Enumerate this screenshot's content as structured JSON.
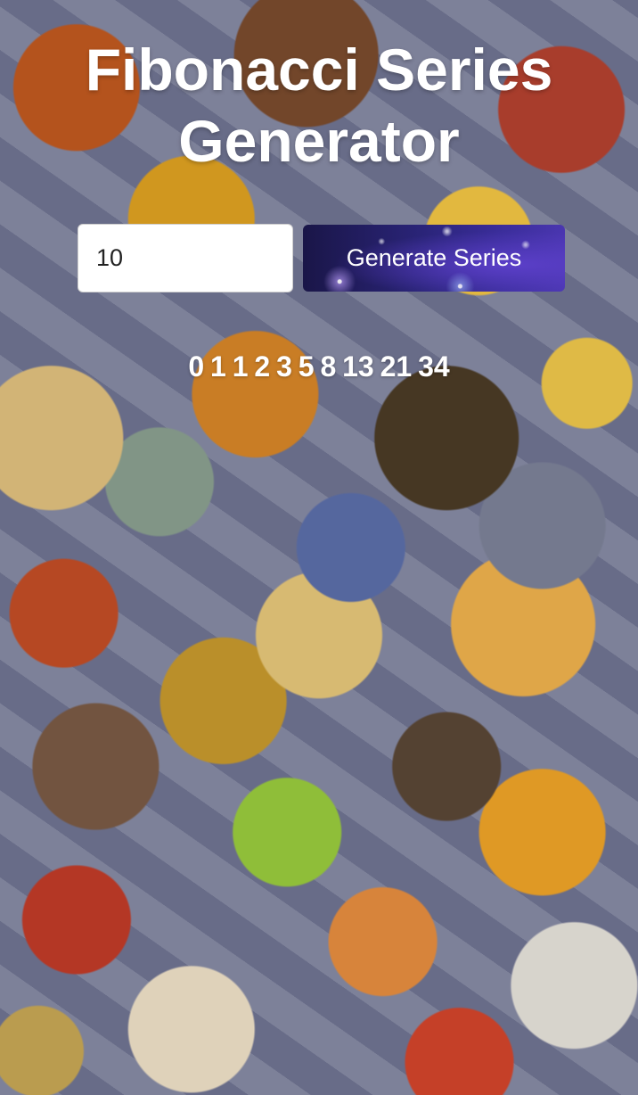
{
  "app": {
    "title": "Fibonacci Series Generator"
  },
  "form": {
    "count_value": "10",
    "generate_label": "Generate Series"
  },
  "result": {
    "series_text": "0 1 1 2 3 5 8 13 21 34"
  },
  "colors": {
    "text": "#ffffff",
    "button_gradient_start": "#1a1648",
    "button_gradient_end": "#4a36b0"
  }
}
